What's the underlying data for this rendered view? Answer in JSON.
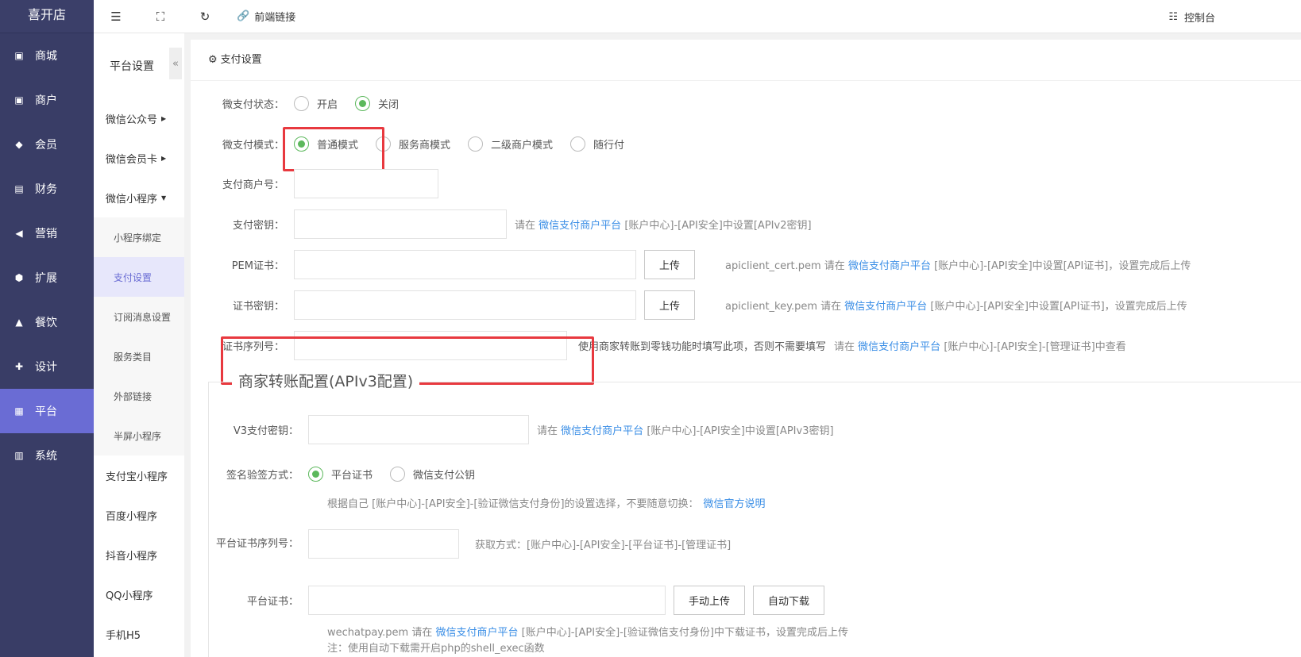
{
  "brand": "喜开店",
  "nav": [
    {
      "label": "商城",
      "icon": "shop-icon"
    },
    {
      "label": "商户",
      "icon": "merchant-icon"
    },
    {
      "label": "会员",
      "icon": "member-icon"
    },
    {
      "label": "财务",
      "icon": "finance-icon"
    },
    {
      "label": "营销",
      "icon": "megaphone-icon"
    },
    {
      "label": "扩展",
      "icon": "cube-icon"
    },
    {
      "label": "餐饮",
      "icon": "dining-icon"
    },
    {
      "label": "设计",
      "icon": "puzzle-icon"
    },
    {
      "label": "平台",
      "icon": "grid-icon"
    },
    {
      "label": "系统",
      "icon": "monitor-icon"
    }
  ],
  "subnav": {
    "title": "平台设置",
    "items": [
      "微信公众号",
      "微信会员卡",
      "微信小程序"
    ],
    "children": [
      "小程序绑定",
      "支付设置",
      "订阅消息设置",
      "服务类目",
      "外部链接",
      "半屏小程序"
    ],
    "more": [
      "支付宝小程序",
      "百度小程序",
      "抖音小程序",
      "QQ小程序",
      "手机H5"
    ]
  },
  "topbar": {
    "frontend_link": "前端链接",
    "console": "控制台"
  },
  "panel": {
    "title": "支付设置",
    "status_label": "微支付状态：",
    "status_options": [
      "开启",
      "关闭"
    ],
    "mode_label": "微支付模式：",
    "mode_options": [
      "普通模式",
      "服务商模式",
      "二级商户模式",
      "随行付"
    ],
    "merchant_no_label": "支付商户号：",
    "secret_label": "支付密钥：",
    "secret_hint_pre": "请在",
    "platform_link": "微信支付商户平台",
    "secret_hint_post": "[账户中心]-[API安全]中设置[APIv2密钥]",
    "pem_label": "PEM证书：",
    "upload": "上传",
    "pem_hint_pre": "apiclient_cert.pem 请在",
    "pem_hint_post": "[账户中心]-[API安全]中设置[API证书]，设置完成后上传",
    "key_label": "证书密钥：",
    "key_hint_pre": "apiclient_key.pem 请在",
    "key_hint_post": "[账户中心]-[API安全]中设置[API证书]，设置完成后上传",
    "serial_label": "证书序列号：",
    "serial_hint1": "使用商家转账到零钱功能时填写此项，否则不需要填写",
    "serial_hint2_pre": "请在",
    "serial_hint2_post": "[账户中心]-[API安全]-[管理证书]中查看",
    "legend": "商家转账配置(APIv3配置)",
    "v3_label": "V3支付密钥：",
    "v3_hint_pre": "请在",
    "v3_hint_post": "[账户中心]-[API安全]中设置[APIv3密钥]",
    "sign_label": "签名验签方式：",
    "sign_options": [
      "平台证书",
      "微信支付公钥"
    ],
    "sign_hint": "根据自己 [账户中心]-[API安全]-[验证微信支付身份]的设置选择，不要随意切换：",
    "sign_hint_link": "微信官方说明",
    "plat_serial_label": "平台证书序列号：",
    "plat_serial_hint": "获取方式：[账户中心]-[API安全]-[平台证书]-[管理证书]",
    "plat_cert_label": "平台证书：",
    "manual_upload": "手动上传",
    "auto_download": "自动下载",
    "plat_cert_hint_pre": "wechatpay.pem 请在",
    "plat_cert_hint_post": "[账户中心]-[API安全]-[验证微信支付身份]中下载证书，设置完成后上传",
    "plat_cert_note": "注：使用自动下载需开启php的shell_exec函数"
  }
}
